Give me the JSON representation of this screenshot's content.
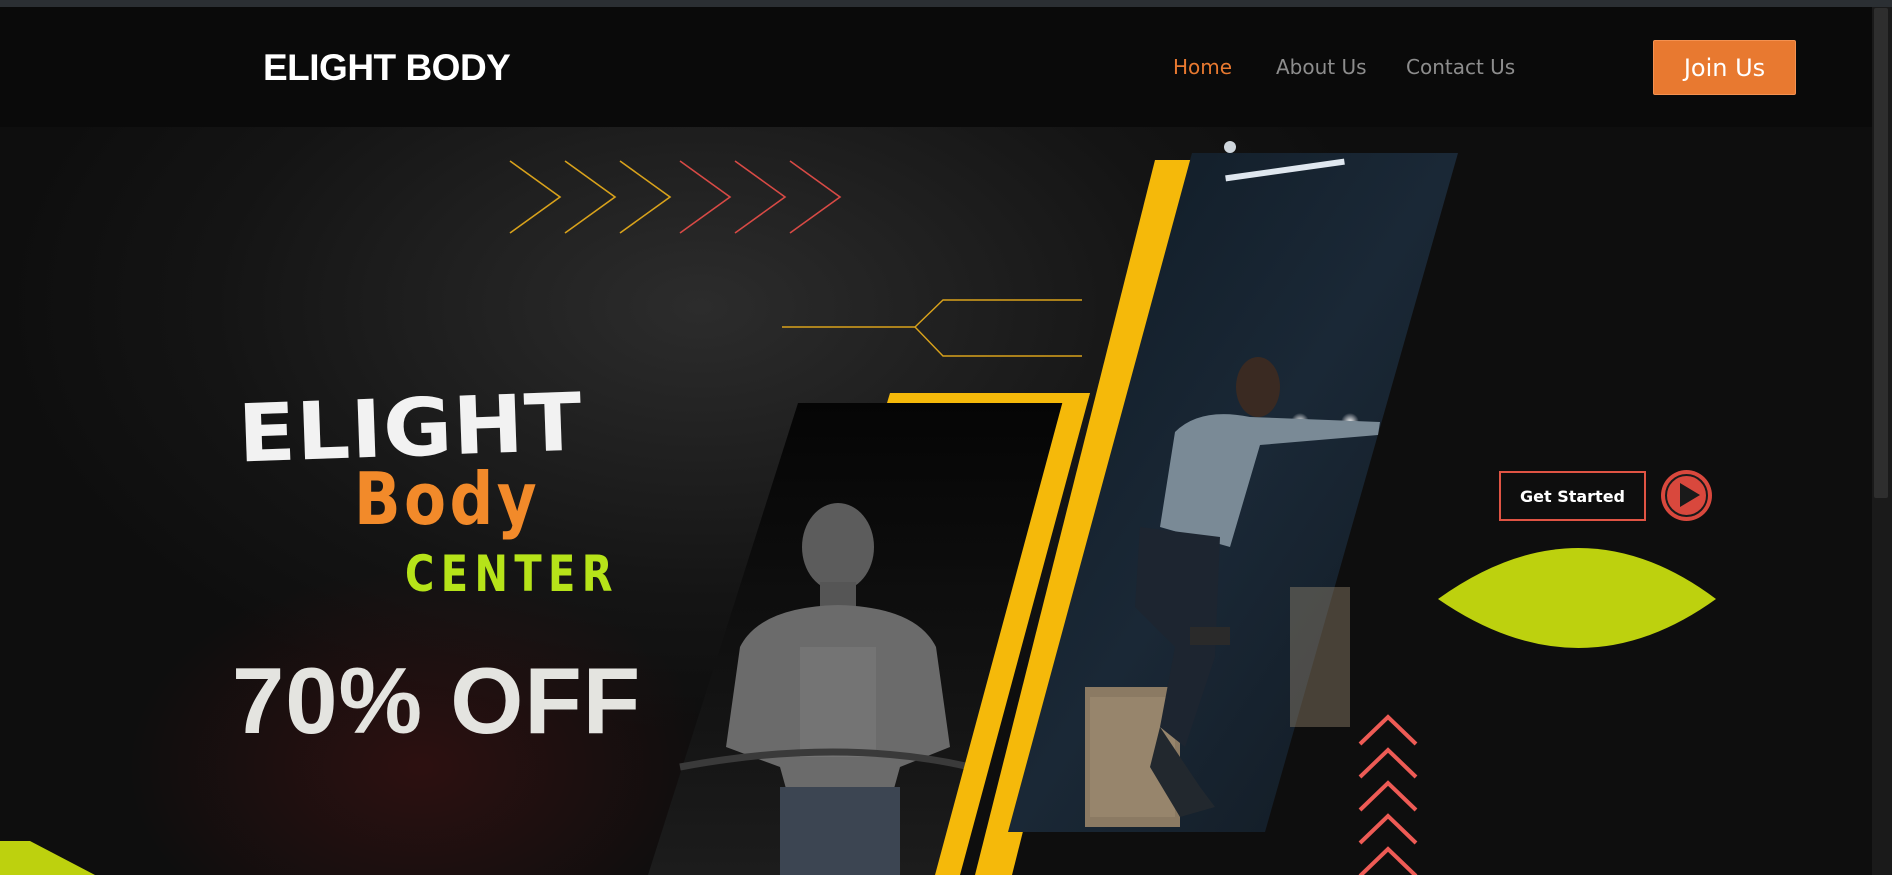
{
  "header": {
    "logo": "ELIGHT BODY",
    "nav": [
      {
        "label": "Home",
        "active": true
      },
      {
        "label": "About Us",
        "active": false
      },
      {
        "label": "Contact Us",
        "active": false
      }
    ],
    "cta_label": "Join Us"
  },
  "hero": {
    "brand_line1": "ELIGHT",
    "brand_line2": "Body",
    "brand_line3": "CENTER",
    "promo": "70% OFF",
    "get_started_label": "Get Started",
    "images": {
      "left": "man-with-barbell-photo",
      "right": "woman-with-dumbbells-photo"
    }
  },
  "colors": {
    "accent_orange": "#e87930",
    "yellow": "#ffc107",
    "lime": "#bdd10e",
    "red": "#e05444",
    "background": "#0b0b0b"
  },
  "icons": [
    "play-icon",
    "chevron-right-icon",
    "chevron-up-icon"
  ]
}
